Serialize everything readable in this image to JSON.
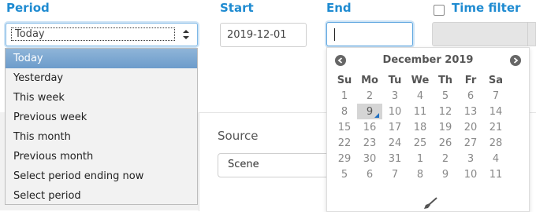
{
  "labels": {
    "period": "Period",
    "start": "Start",
    "end": "End",
    "time_filter": "Time filter"
  },
  "period_select": {
    "value": "Today"
  },
  "period_options": [
    "Today",
    "Yesterday",
    "This week",
    "Previous week",
    "This month",
    "Previous month",
    "Select period ending now",
    "Select period"
  ],
  "start_value": "2019-12-01",
  "end_value": "",
  "source": {
    "label": "Source",
    "value": "Scene"
  },
  "calendar": {
    "month_label": "December 2019",
    "weekdays": [
      "Su",
      "Mo",
      "Tu",
      "We",
      "Th",
      "Fr",
      "Sa"
    ],
    "weeks": [
      [
        "1",
        "2",
        "3",
        "4",
        "5",
        "6",
        "7"
      ],
      [
        "8",
        "9",
        "10",
        "11",
        "12",
        "13",
        "14"
      ],
      [
        "15",
        "16",
        "17",
        "18",
        "19",
        "20",
        "21"
      ],
      [
        "22",
        "23",
        "24",
        "25",
        "26",
        "27",
        "28"
      ],
      [
        "29",
        "30",
        "31",
        "1",
        "2",
        "3",
        "4"
      ],
      [
        "5",
        "6",
        "7",
        "8",
        "9",
        "10",
        "11"
      ]
    ],
    "today": "9"
  }
}
